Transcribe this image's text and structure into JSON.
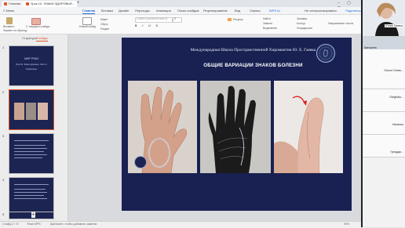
{
  "titlebar": {
    "home_tab": "Главная",
    "doc_tab": "Урок 10. ЗНАКИ ЗДОРОВЬЯ...",
    "new_tab": "+",
    "window_controls": "–  ▢  ✕"
  },
  "menubar": {
    "menu": "≡ Меню",
    "items": [
      "Главная",
      "Вставка",
      "Дизайн",
      "Переходы",
      "Анимация",
      "Показ слайдов",
      "Рецензирование",
      "Вид",
      "Сервис",
      "WPS AI"
    ],
    "active": "Главная",
    "right_status": "Не синхронизировано",
    "share": "Поделиться"
  },
  "ribbon": {
    "paste": "Вставить",
    "format_painter": "Формат по образцу",
    "new_slide": "Новый слайд",
    "from_current": "С текущего слайда",
    "layout": "Макет",
    "reset": "Сброс",
    "section": "Раздел",
    "font_name": "(Calibri (основной текст))",
    "font_size": "0",
    "picture": "Рисунок",
    "draw": "Рисунок",
    "find": "Найти",
    "replace": "Замена",
    "select": "Выделение",
    "arrange": "Упорядочить",
    "fill": "Заливка",
    "outline": "Контур",
    "align_text": "Выровнять текст",
    "direction": "Направление текста"
  },
  "leftpanel": {
    "tab_outline": "Структура",
    "tab_slides": "Слайды",
    "slides": [
      {
        "num": "1",
        "line1": "МИР РУКИ",
        "line2": "Урок 10. Знаки здоровья. Часть 1",
        "line3": "Сифоновые"
      },
      {
        "num": "2"
      },
      {
        "num": "3"
      },
      {
        "num": "4"
      },
      {
        "num": "5"
      }
    ],
    "add_slide": "+"
  },
  "slide": {
    "subtitle": "Международная Школа Пространственной Хиромантии Ю. Е. Гаевка",
    "title": "ОБЩИЕ ВАРИАЦИИ ЗНАКОВ БОЛЕЗНИ"
  },
  "statusbar": {
    "slide_counter": "Слайд 2 / 72",
    "theme": "Тема WPS",
    "notes_placeholder": "Щелкните, чтобы добавить заметки",
    "zoom": "90%"
  },
  "participants": [
    {
      "name": "Юлия Гаевка"
    },
    {
      "name": "Катерина"
    },
    {
      "name": "Ольга Стемо..."
    },
    {
      "name": "OlegKalu..."
    },
    {
      "name": "Наталья"
    },
    {
      "name": "Гульдар..."
    }
  ],
  "colors": {
    "accent": "#1e6bd6",
    "slide_bg": "#182152",
    "selection": "#e0542b"
  }
}
